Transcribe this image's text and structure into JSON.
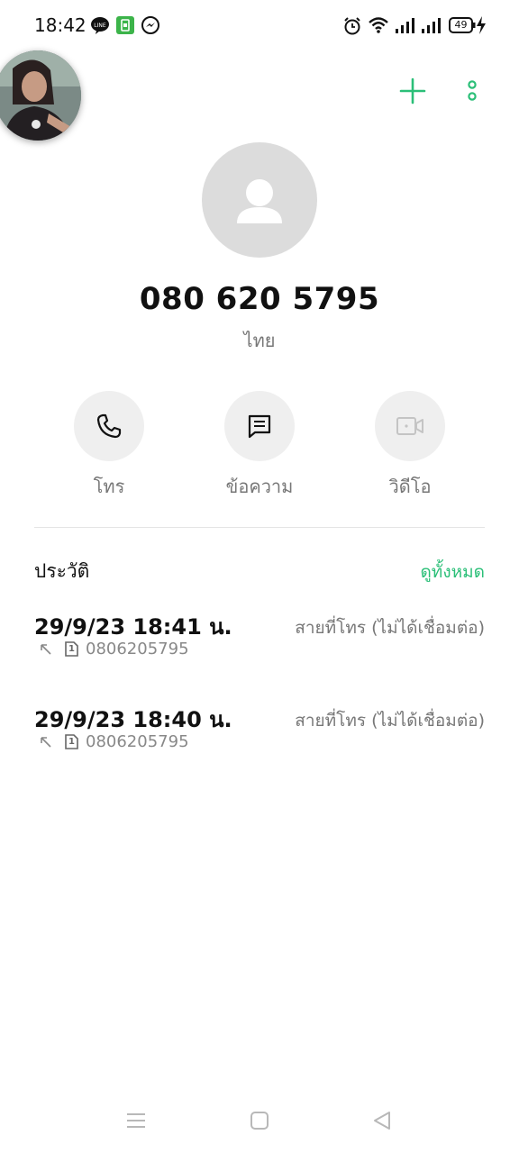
{
  "status_bar": {
    "time": "18:42",
    "battery": "49",
    "notification_icons": [
      "line-icon",
      "sim-app-icon",
      "messenger-icon"
    ],
    "system_icons": [
      "alarm-icon",
      "wifi-icon",
      "signal-icon",
      "signal-icon",
      "battery-icon",
      "charging-icon"
    ]
  },
  "header": {
    "add_icon": "plus-icon",
    "more_icon": "more-vertical-icon"
  },
  "contact": {
    "number": "080 620 5795",
    "location": "ไทย"
  },
  "actions": [
    {
      "label": "โทร",
      "icon": "phone-icon"
    },
    {
      "label": "ข้อความ",
      "icon": "message-icon"
    },
    {
      "label": "วิดีโอ",
      "icon": "video-icon"
    }
  ],
  "history": {
    "title": "ประวัติ",
    "view_all": "ดูทั้งหมด",
    "calls": [
      {
        "time": "29/9/23 18:41 น.",
        "sim": "1",
        "number": "0806205795",
        "status": "สายที่โทร (ไม่ได้เชื่อมต่อ)"
      },
      {
        "time": "29/9/23 18:40 น.",
        "sim": "1",
        "number": "0806205795",
        "status": "สายที่โทร (ไม่ได้เชื่อมต่อ)"
      }
    ]
  },
  "colors": {
    "accent": "#2bbf78",
    "line_green": "#06c755",
    "avatar_bg": "#dcdcdc",
    "action_bg": "#efefef"
  }
}
